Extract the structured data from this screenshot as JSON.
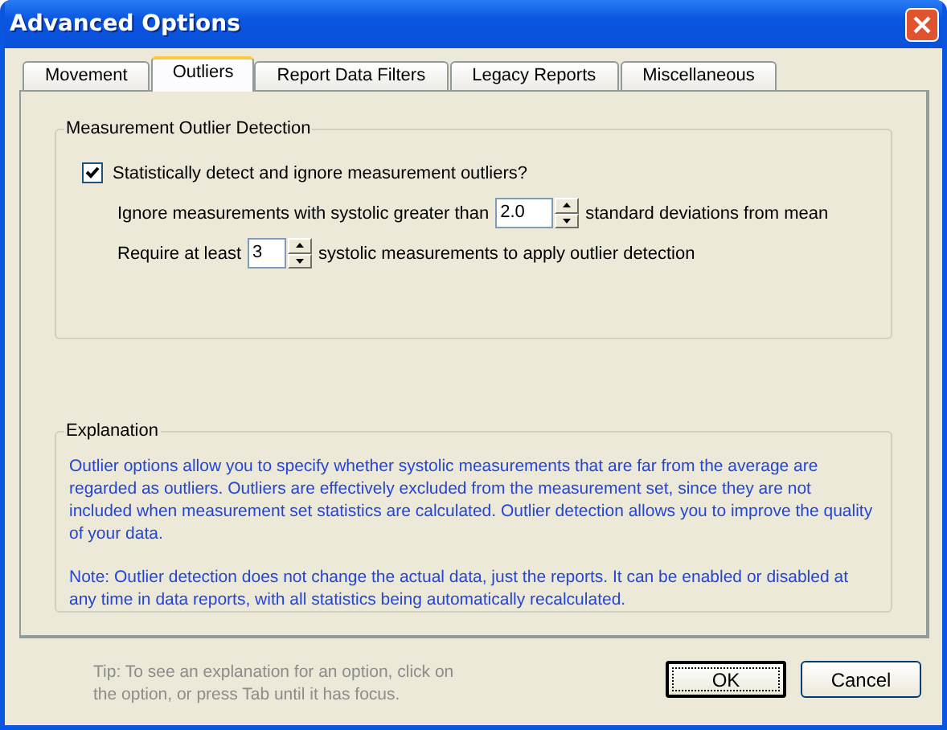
{
  "window": {
    "title": "Advanced Options"
  },
  "tabs": [
    {
      "label": "Movement",
      "selected": false
    },
    {
      "label": "Outliers",
      "selected": true
    },
    {
      "label": "Report Data Filters",
      "selected": false
    },
    {
      "label": "Legacy Reports",
      "selected": false
    },
    {
      "label": "Miscellaneous",
      "selected": false
    }
  ],
  "outlier_group": {
    "title": "Measurement Outlier Detection",
    "detect_checkbox": {
      "label": "Statistically detect and ignore measurement outliers?",
      "checked": true
    },
    "rows": [
      {
        "before": "Ignore measurements with systolic greater than",
        "value": "2.0",
        "after": "standard deviations from mean"
      },
      {
        "before": "Require at least",
        "value": "3",
        "after": "systolic measurements to apply outlier detection"
      }
    ]
  },
  "explanation": {
    "title": "Explanation",
    "paragraphs": [
      "Outlier options allow you to specify whether systolic measurements that are far from the average are regarded as outliers. Outliers are effectively excluded from the measurement set, since they are not included when measurement set statistics are calculated. Outlier detection allows you to improve the quality of your data.",
      "Note: Outlier detection does not change the actual data, just the reports. It can be enabled or disabled at any time in data reports, with all statistics being automatically recalculated."
    ]
  },
  "tip": "Tip: To see an explanation for an option, click on the option, or press Tab until it has focus.",
  "buttons": [
    {
      "label": "OK",
      "default": true
    },
    {
      "label": "Cancel",
      "default": false
    }
  ]
}
